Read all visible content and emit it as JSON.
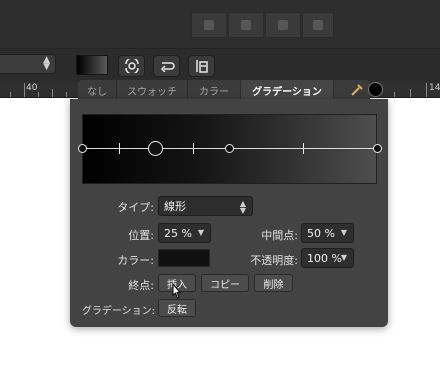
{
  "ruler": {
    "numbers": [
      "40",
      "14"
    ]
  },
  "tabs": [
    {
      "label": "なし",
      "active": false
    },
    {
      "label": "スウォッチ",
      "active": false
    },
    {
      "label": "カラー",
      "active": false
    },
    {
      "label": "グラデーション",
      "active": true
    }
  ],
  "colors": {
    "panel": "#434343",
    "selected_color": "#000000",
    "gradient_start": "#000000",
    "gradient_end": "#4e4e4e"
  },
  "gradient_editor": {
    "stops": [
      0,
      25,
      50,
      100
    ],
    "selected_stop": 25,
    "midpoints": [
      12.5,
      37.5,
      75
    ]
  },
  "fields": {
    "type_label": "タイプ:",
    "type_value": "線形",
    "position_label": "位置:",
    "position_value": "25 %",
    "midpoint_label": "中間点:",
    "midpoint_value": "50 %",
    "color_label": "カラー:",
    "opacity_label": "不透明度:",
    "opacity_value": "100 %",
    "stop_label": "終点:",
    "insert_button": "挿入",
    "copy_button": "コピー",
    "delete_button": "削除",
    "gradient_label": "グラデーション:",
    "reverse_button": "反転"
  },
  "icons": [
    "arrange-icon",
    "wrap-icon",
    "transform-icon",
    "eyedropper-icon",
    "pointer-cursor"
  ]
}
